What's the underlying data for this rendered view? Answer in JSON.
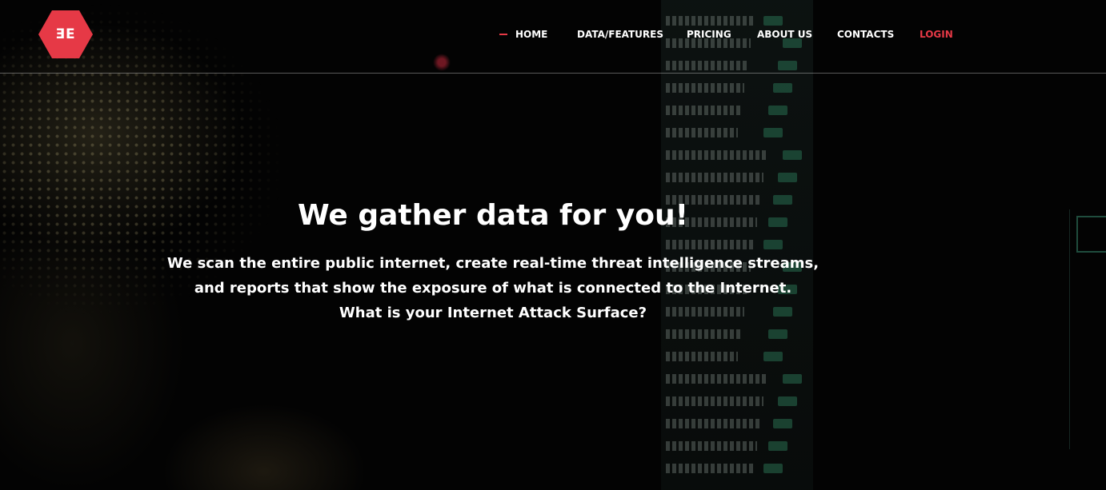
{
  "header": {
    "logo_text": "ƎE",
    "brand_color": "#e63946",
    "nav": [
      {
        "label": "HOME"
      },
      {
        "label": "DATA/FEATURES"
      },
      {
        "label": "PRICING"
      },
      {
        "label": "ABOUT US"
      },
      {
        "label": "CONTACTS"
      },
      {
        "label": "LOGIN"
      }
    ]
  },
  "hero": {
    "title": "We gather data for you!",
    "lines": [
      "We scan the entire public internet, create real-time threat intelligence streams,",
      "and reports that show the exposure of what is connected to the Internet.",
      "What is your Internet Attack Surface?"
    ]
  }
}
